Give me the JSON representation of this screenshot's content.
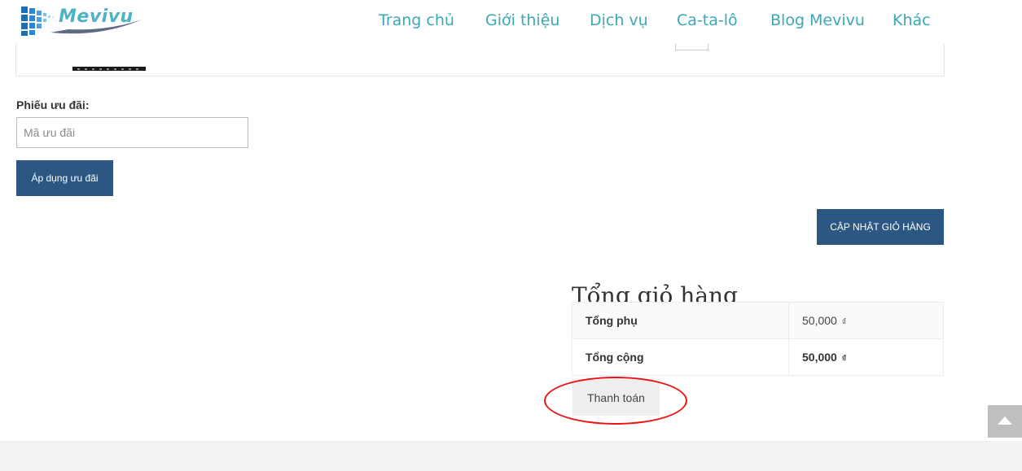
{
  "header": {
    "logo_text": "Mevivu",
    "nav": [
      {
        "label": "Trang chủ"
      },
      {
        "label": "Giới thiệu"
      },
      {
        "label": "Dịch vụ"
      },
      {
        "label": "Ca-ta-lô"
      },
      {
        "label": "Blog Mevivu"
      },
      {
        "label": "Khác"
      }
    ]
  },
  "coupon": {
    "label": "Phiếu ưu đãi:",
    "placeholder": "Mã ưu đãi",
    "apply_label": "Áp dụng ưu đãi"
  },
  "cart": {
    "update_label": "CẬP NHẬT GIỎ HÀNG"
  },
  "totals": {
    "title": "Tổng giỏ hàng",
    "subtotal_label": "Tổng phụ",
    "subtotal_value": "50,000",
    "total_label": "Tổng cộng",
    "total_value": "50,000",
    "currency": "₫",
    "checkout_label": "Thanh toán"
  },
  "icons": {
    "scroll_top": "chevron-up-icon",
    "logo": "mevivu-logo-icon"
  },
  "colors": {
    "accent": "#2b5782",
    "nav_text": "#3aa8b6",
    "highlight": "#e11111"
  }
}
